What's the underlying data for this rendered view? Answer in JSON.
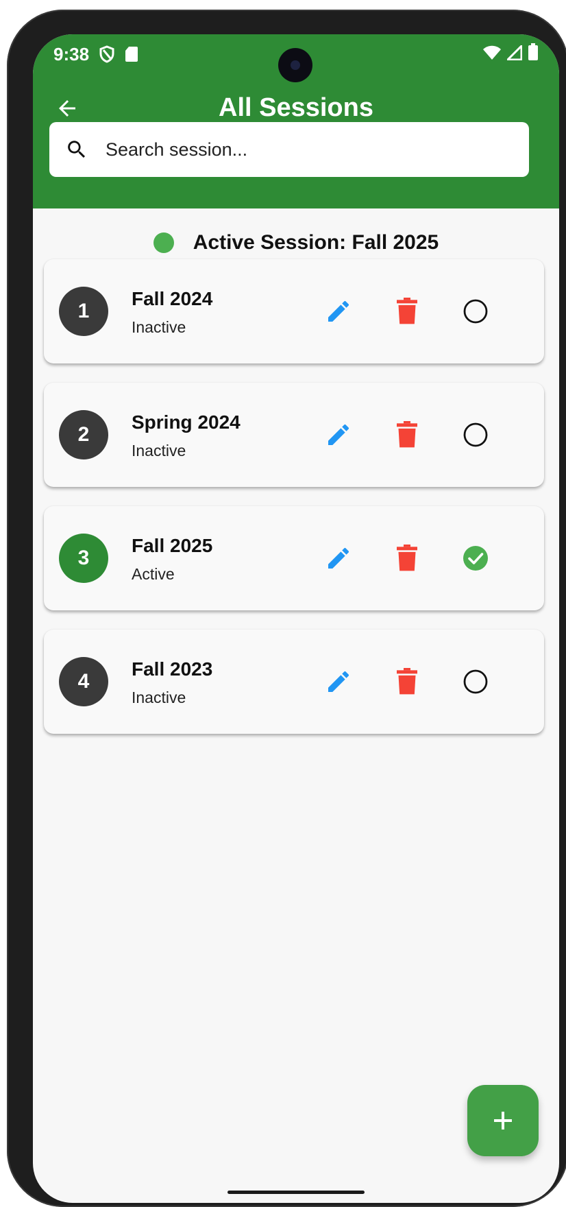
{
  "status_bar": {
    "time": "9:38"
  },
  "header": {
    "title": "All Sessions",
    "back_icon": "arrow-left-icon"
  },
  "search": {
    "placeholder": "Search session...",
    "value": ""
  },
  "active_session": {
    "text": "Active Session: Fall 2025",
    "dot_color": "#4caf50"
  },
  "sessions": [
    {
      "number": "1",
      "name": "Fall 2024",
      "status": "Inactive",
      "is_active": false
    },
    {
      "number": "2",
      "name": "Spring 2024",
      "status": "Inactive",
      "is_active": false
    },
    {
      "number": "3",
      "name": "Fall 2025",
      "status": "Active",
      "is_active": true
    },
    {
      "number": "4",
      "name": "Fall 2023",
      "status": "Inactive",
      "is_active": false
    }
  ],
  "fab": {
    "icon": "plus-icon"
  },
  "colors": {
    "primary": "#2e8b35",
    "edit": "#2196f3",
    "delete": "#f44336",
    "check": "#4caf50",
    "badge_inactive": "#3a3a3a"
  }
}
